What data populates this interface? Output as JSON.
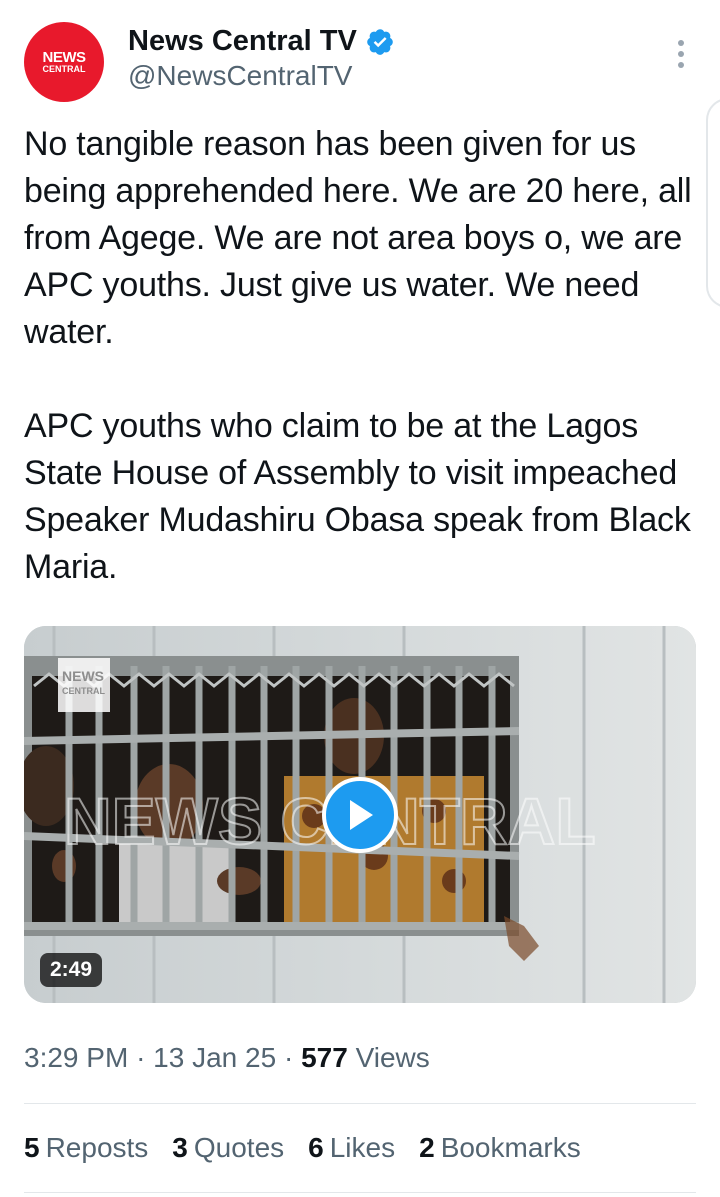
{
  "author": {
    "name": "News Central TV",
    "handle": "@NewsCentralTV",
    "avatar_line1": "NEWS",
    "avatar_line2": "CENTRAL",
    "verified_icon": "verified-badge-icon",
    "brand_color": "#e8192c"
  },
  "tweet": {
    "text": "No tangible reason has been given for us being apprehended here. We are 20 here, all from Agege. We are not area boys o, we are APC youths. Just give us water. We need water.\n\nAPC youths who claim to be at the Lagos State House of Assembly to visit impeached Speaker Mudashiru Obasa speak from Black Maria."
  },
  "media": {
    "type": "video",
    "duration": "2:49",
    "watermark_logo_line1": "NEWS",
    "watermark_logo_line2": "CENTRAL",
    "watermark_text": "NEWS CENTRAL",
    "play_icon": "play-icon"
  },
  "meta": {
    "time": "3:29 PM",
    "separator": "·",
    "date": "13 Jan 25",
    "views_count": "577",
    "views_label": "Views"
  },
  "stats": [
    {
      "count": "5",
      "label": "Reposts"
    },
    {
      "count": "3",
      "label": "Quotes"
    },
    {
      "count": "6",
      "label": "Likes"
    },
    {
      "count": "2",
      "label": "Bookmarks"
    }
  ],
  "colors": {
    "accent": "#1d9bf0",
    "text_primary": "#0f1419",
    "text_secondary": "#536471"
  }
}
